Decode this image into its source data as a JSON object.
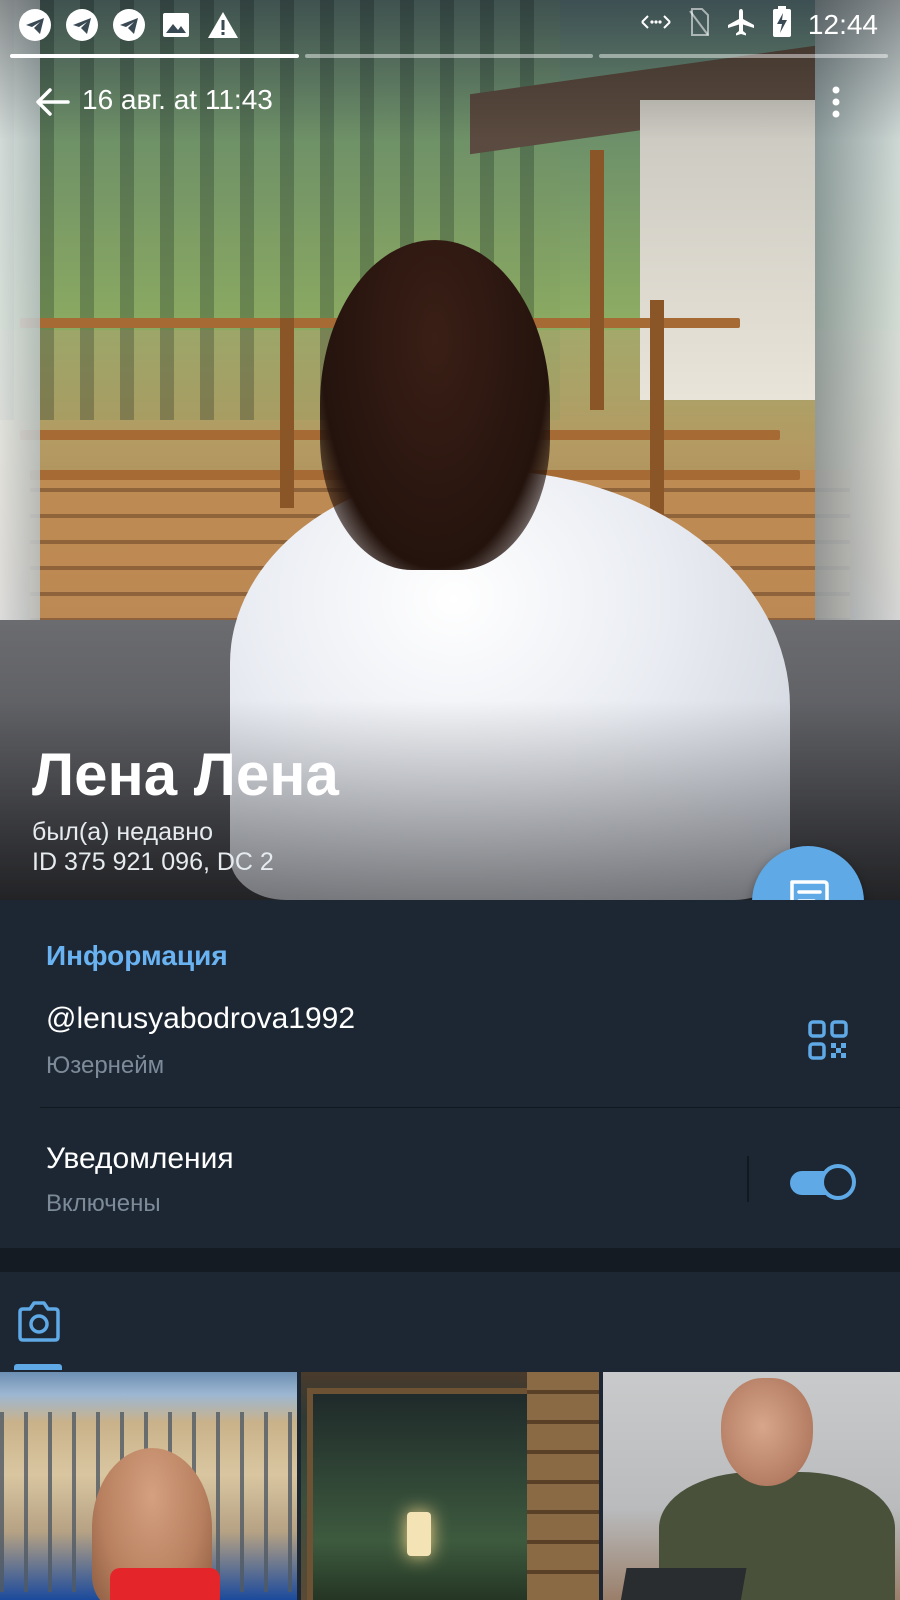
{
  "status_bar": {
    "time": "12:44",
    "left_icons": [
      "telegram-icon",
      "telegram-icon",
      "telegram-icon",
      "image-icon",
      "warning-icon"
    ],
    "right_icons": [
      "data-transfer-icon",
      "no-sim-icon",
      "airplane-icon",
      "battery-charging-icon"
    ]
  },
  "story": {
    "segments": 3,
    "active_segment": 1
  },
  "toolbar": {
    "title": "16 авг. at 11:43"
  },
  "profile": {
    "name": "Лена Лена",
    "status": "был(а) недавно",
    "id_line": "ID 375 921 096, DC 2"
  },
  "info": {
    "section_title": "Информация",
    "username": "@lenusyabodrova1992",
    "username_label": "Юзернейм",
    "notifications_title": "Уведомления",
    "notifications_value": "Включены",
    "notifications_enabled": true
  },
  "media": {
    "active_tab": "photos",
    "thumbnails": [
      "pool-photo",
      "sauna-photo",
      "portrait-photo"
    ]
  },
  "colors": {
    "accent": "#5ea9e6",
    "link": "#6ab3f2",
    "background": "#1d2733",
    "secondary_text": "#7d8b99"
  }
}
